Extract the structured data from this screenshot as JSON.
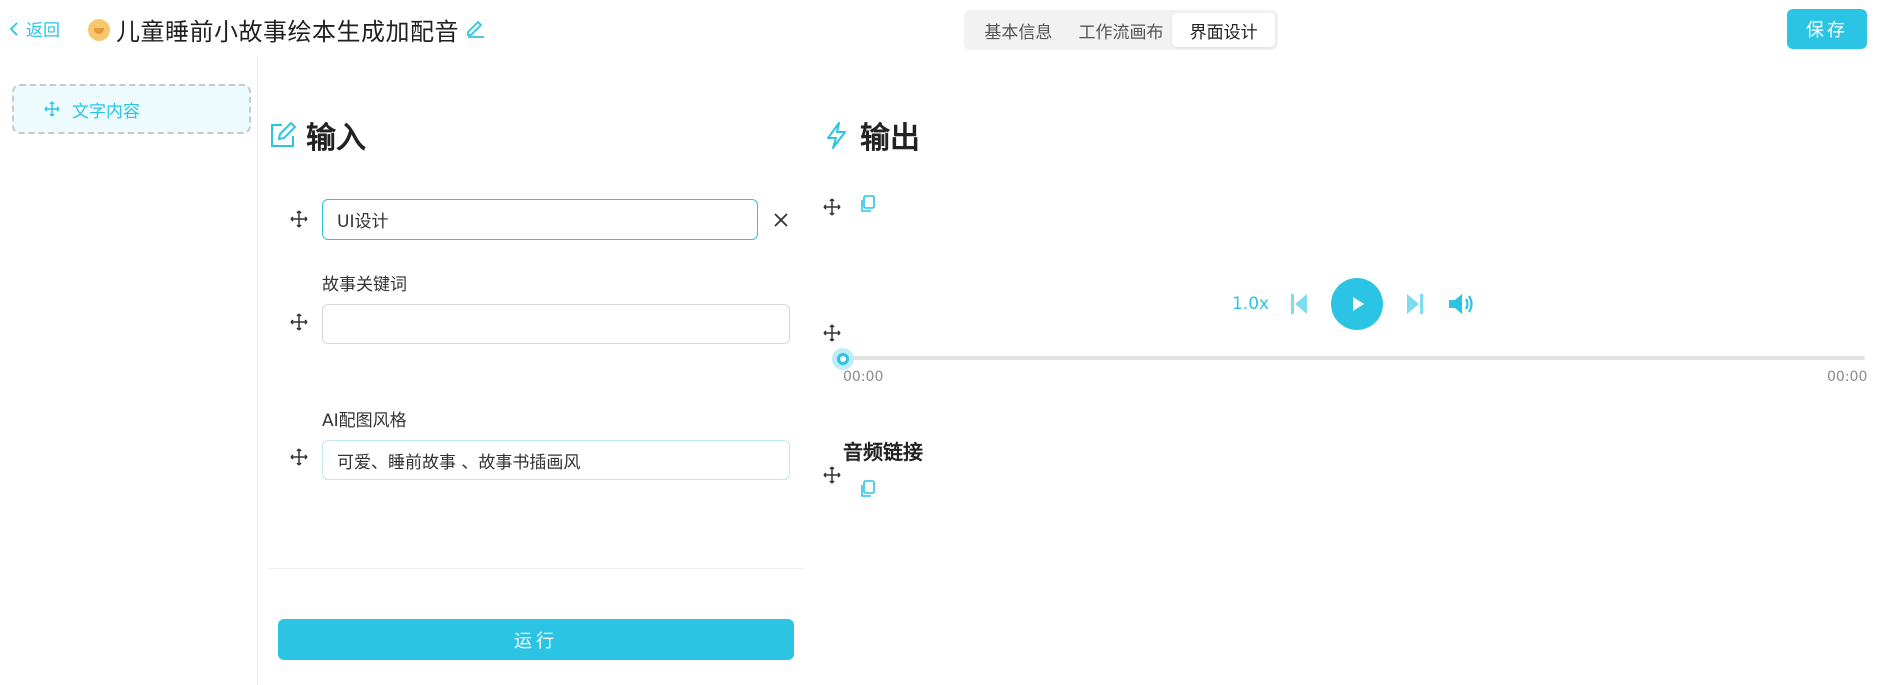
{
  "header": {
    "back_label": "返回",
    "title": "儿童睡前小故事绘本生成加配音",
    "title_icon": "baby-face-icon",
    "tabs": [
      {
        "label": "基本信息",
        "active": false
      },
      {
        "label": "工作流画布",
        "active": false
      },
      {
        "label": "界面设计",
        "active": true
      }
    ],
    "save_label": "保存"
  },
  "sidebar": {
    "text_block_label": "文字内容"
  },
  "input_section": {
    "title": "输入",
    "fields": [
      {
        "label": "",
        "value": "UI设计",
        "placeholder": ""
      },
      {
        "label": "故事关键词",
        "value": "",
        "placeholder": ""
      },
      {
        "label": "AI配图风格",
        "value": "可爱、睡前故事 、故事书插画风",
        "placeholder": ""
      }
    ],
    "run_label": "运行"
  },
  "output_section": {
    "title": "输出",
    "player": {
      "speed": "1.0x",
      "current_time": "00:00",
      "duration": "00:00",
      "progress": 0
    },
    "audio_link_label": "音频链接"
  },
  "colors": {
    "accent": "#2bc4e4",
    "accent_light": "#edfbfe"
  }
}
